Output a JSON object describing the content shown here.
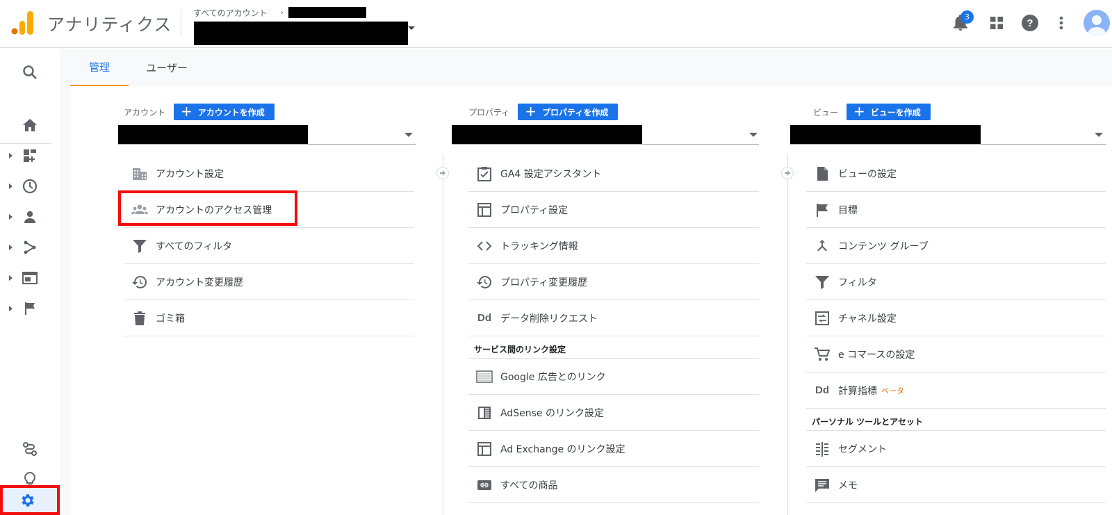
{
  "header": {
    "app_title": "アナリティクス",
    "account_selector_label": "すべてのアカウント",
    "notifications_count": "3",
    "icons": [
      "analytics-logo-icon",
      "bell-icon",
      "apps-grid-icon",
      "help-icon",
      "more-vert-icon",
      "avatar-icon"
    ]
  },
  "leftnav": {
    "items": [
      "search-icon",
      "home-icon",
      "dashboard-icon",
      "clock-icon",
      "person-icon",
      "acquisition-icon",
      "behavior-icon",
      "flag-icon"
    ],
    "bottom": [
      "attribution-icon",
      "lightbulb-icon",
      "gear-icon"
    ]
  },
  "tabs": [
    {
      "label": "管理",
      "active": true
    },
    {
      "label": "ユーザー",
      "active": false
    }
  ],
  "account_col": {
    "label": "アカウント",
    "create_button": "アカウントを作成",
    "items": [
      {
        "label": "アカウント設定",
        "icon": "building-icon"
      },
      {
        "label": "アカウントのアクセス管理",
        "icon": "people-icon"
      },
      {
        "label": "すべてのフィルタ",
        "icon": "filter-icon"
      },
      {
        "label": "アカウント変更履歴",
        "icon": "history-icon"
      },
      {
        "label": "ゴミ箱",
        "icon": "trash-icon"
      }
    ]
  },
  "property_col": {
    "label": "プロパティ",
    "create_button": "プロパティを作成",
    "items": [
      {
        "label": "GA4 設定アシスタント",
        "icon": "checklist-icon"
      },
      {
        "label": "プロパティ設定",
        "icon": "layout-icon"
      },
      {
        "label": "トラッキング情報",
        "icon": "code-icon"
      },
      {
        "label": "プロパティ変更履歴",
        "icon": "history-icon"
      },
      {
        "label": "データ削除リクエスト",
        "icon": "dd-icon"
      }
    ],
    "section_title": "サービス間のリンク設定",
    "link_items": [
      {
        "label": "Google 広告とのリンク",
        "icon": "ads-icon"
      },
      {
        "label": "AdSense のリンク設定",
        "icon": "adsense-icon"
      },
      {
        "label": "Ad Exchange のリンク設定",
        "icon": "layout-icon"
      },
      {
        "label": "すべての商品",
        "icon": "link-icon"
      }
    ]
  },
  "view_col": {
    "label": "ビュー",
    "create_button": "ビューを作成",
    "items": [
      {
        "label": "ビューの設定",
        "icon": "document-icon"
      },
      {
        "label": "目標",
        "icon": "flag-icon"
      },
      {
        "label": "コンテンツ グループ",
        "icon": "merge-icon"
      },
      {
        "label": "フィルタ",
        "icon": "filter-icon"
      },
      {
        "label": "チャネル設定",
        "icon": "channel-icon"
      },
      {
        "label": "e コマースの設定",
        "icon": "cart-icon"
      },
      {
        "label": "計算指標",
        "icon": "dd-icon",
        "badge": "ベータ"
      }
    ],
    "section_title": "パーソナル ツールとアセット",
    "tool_items": [
      {
        "label": "セグメント",
        "icon": "segment-icon"
      },
      {
        "label": "メモ",
        "icon": "comment-icon"
      }
    ]
  },
  "colors": {
    "accent": "#1a73e8",
    "tab_underline": "#f29900",
    "highlight": "#f20c0c",
    "beta": "#e8710a"
  }
}
